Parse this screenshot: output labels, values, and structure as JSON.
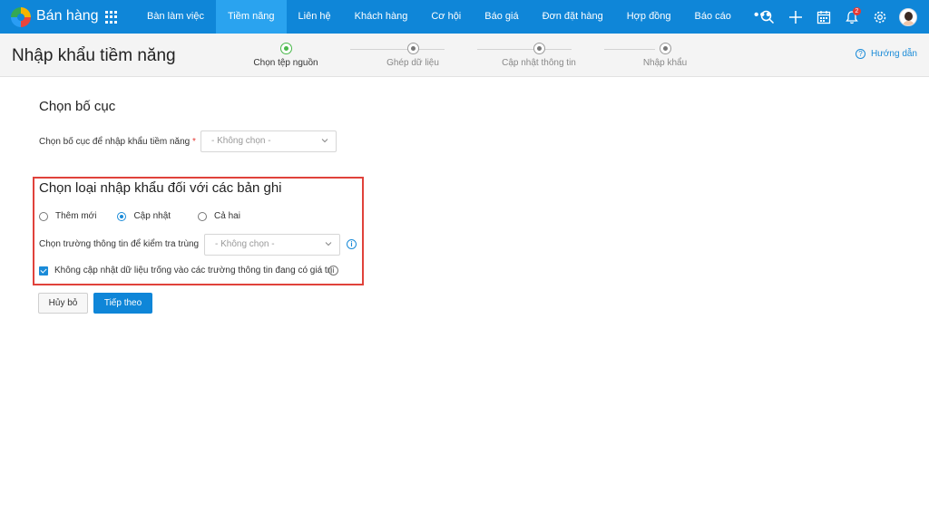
{
  "app": {
    "title": "Bán hàng"
  },
  "nav": {
    "items": [
      "Bàn làm việc",
      "Tiềm năng",
      "Liên hệ",
      "Khách hàng",
      "Cơ hội",
      "Báo giá",
      "Đơn đặt hàng",
      "Hợp đồng",
      "Báo cáo"
    ],
    "active": "Tiềm năng",
    "more": "•••"
  },
  "header_icons": {
    "notification_count": "2"
  },
  "page": {
    "title": "Nhập khẩu tiềm năng",
    "help": "Hướng dẫn"
  },
  "steps": [
    {
      "label": "Chọn tệp nguồn",
      "active": true
    },
    {
      "label": "Ghép dữ liệu",
      "active": false
    },
    {
      "label": "Cập nhật thông tin",
      "active": false
    },
    {
      "label": "Nhập khẩu",
      "active": false
    }
  ],
  "layout_section": {
    "title": "Chọn bố cục",
    "label": "Chọn bố cục để nhập khẩu tiềm năng",
    "required_mark": "*",
    "select_value": "- Không chọn -"
  },
  "import_type_section": {
    "title": "Chọn loại nhập khẩu đối với các bản ghi",
    "options": [
      "Thêm mới",
      "Cập nhật",
      "Cả hai"
    ],
    "selected": "Cập nhật",
    "dup_check_label": "Chọn trường thông tin để kiểm tra trùng",
    "dup_check_value": "- Không chọn -",
    "checkbox_label": "Không cập nhật dữ liệu trống vào các trường thông tin đang có giá trị",
    "checkbox_checked": true
  },
  "buttons": {
    "cancel": "Hủy bỏ",
    "next": "Tiếp theo"
  },
  "colors": {
    "primary": "#0f86d8",
    "active_tab": "#2aa3ef",
    "highlight_border": "#e0423b",
    "step_active": "#49b84a"
  }
}
